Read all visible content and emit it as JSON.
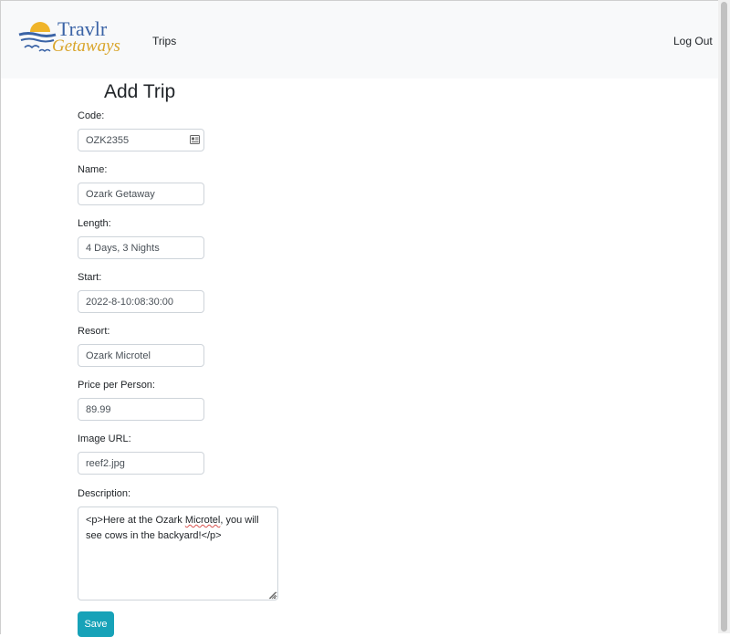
{
  "navbar": {
    "brand": {
      "word1": "Travlr",
      "word2": "Getaways"
    },
    "trips_link": "Trips",
    "logout_link": "Log Out"
  },
  "page": {
    "title": "Add Trip"
  },
  "form": {
    "code": {
      "label": "Code:",
      "value": "OZK2355"
    },
    "name": {
      "label": "Name:",
      "value": "Ozark Getaway"
    },
    "length": {
      "label": "Length:",
      "value": "4 Days, 3 Nights"
    },
    "start": {
      "label": "Start:",
      "value": "2022-8-10:08:30:00"
    },
    "resort": {
      "label": "Resort:",
      "value": "Ozark Microtel"
    },
    "price": {
      "label": "Price per Person:",
      "value": "89.99"
    },
    "image": {
      "label": "Image URL:",
      "value": "reef2.jpg"
    },
    "description": {
      "label": "Description:",
      "text_before": "<p>Here at the Ozark ",
      "misspelled": "Microtel",
      "text_after": ", you will see cows in the backyard!</p>"
    },
    "save_label": "Save"
  },
  "colors": {
    "navbar_bg": "#f8f9fa",
    "save_button": "#17a2b8",
    "logo_blue": "#3a63a6",
    "logo_gold": "#d9a52b"
  }
}
